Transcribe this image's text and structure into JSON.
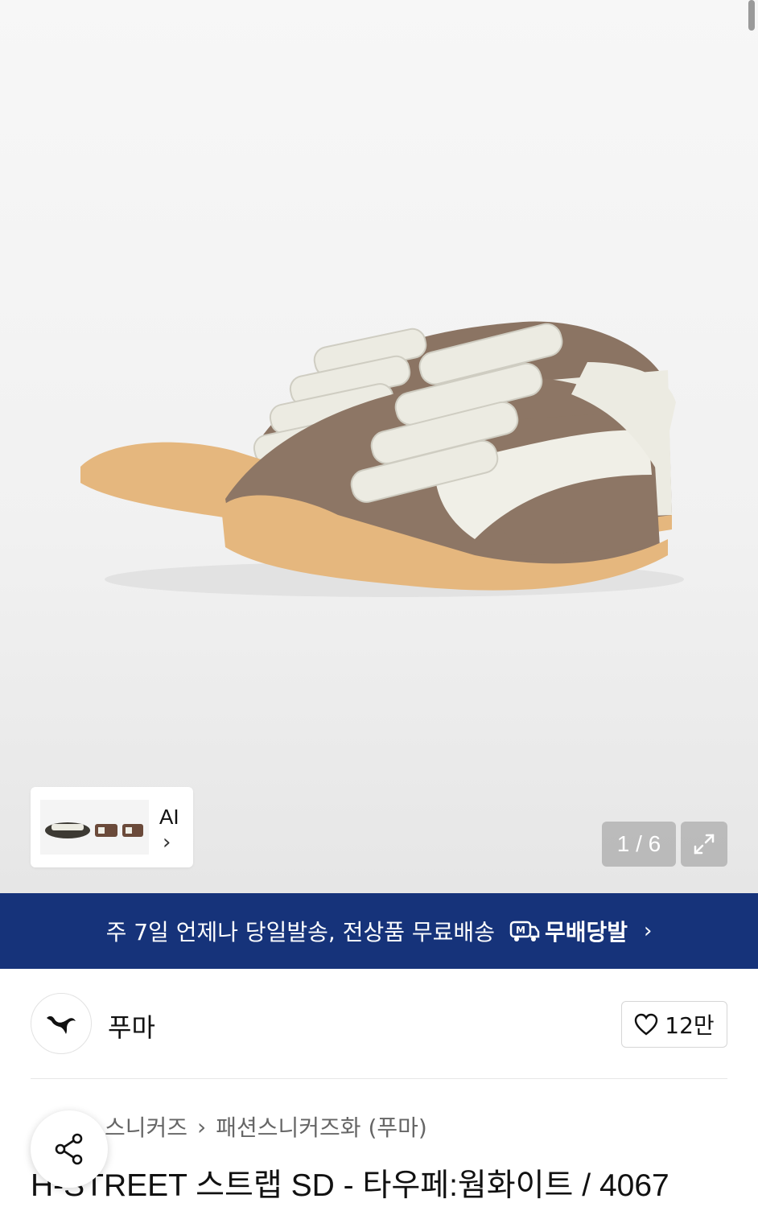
{
  "gallery": {
    "counter": "1 / 6",
    "thumbnail_label": "AI",
    "thumbnail_arrow": "›"
  },
  "banner": {
    "text": "주 7일 언제나 당일발송, 전상품 무료배송",
    "logo_text": "무배당발",
    "arrow": "›"
  },
  "brand": {
    "name": "푸마",
    "likes": "12만"
  },
  "breadcrumb": {
    "items": [
      "스니커즈",
      "패션스니커즈화 (푸마)"
    ],
    "separator": "›"
  },
  "product": {
    "title": "H-STREET 스트랩 SD - 타우페:웜화이트 / 4067"
  },
  "colors": {
    "banner": "#16337a",
    "suede": "#8b7463",
    "leather": "#ecebe2",
    "sole": "#e5b77e"
  }
}
